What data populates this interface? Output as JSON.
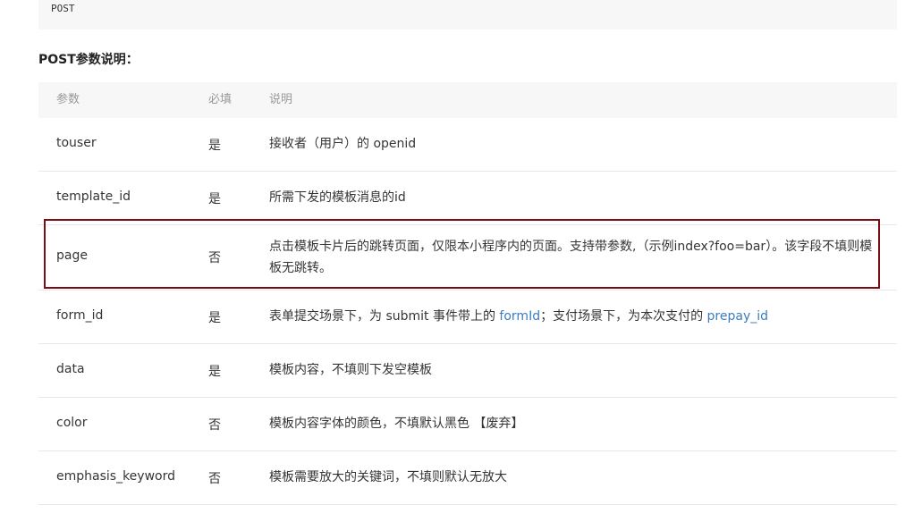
{
  "code_block": {
    "text": "POST"
  },
  "section_title": "POST参数说明：",
  "table": {
    "headers": {
      "param": "参数",
      "required": "必填",
      "desc": "说明"
    },
    "rows": [
      {
        "name": "touser",
        "required": "是",
        "desc": "接收者（用户）的 openid"
      },
      {
        "name": "template_id",
        "required": "是",
        "desc": "所需下发的模板消息的id"
      },
      {
        "name": "page",
        "required": "否",
        "desc": "点击模板卡片后的跳转页面，仅限本小程序内的页面。支持带参数,（示例index?foo=bar）。该字段不填则模板无跳转。"
      },
      {
        "name": "form_id",
        "required": "是",
        "desc_part1": "表单提交场景下，为 submit 事件带上的 ",
        "desc_link1": "formId",
        "desc_part2": "；支付场景下，为本次支付的 ",
        "desc_link2": "prepay_id"
      },
      {
        "name": "data",
        "required": "是",
        "desc": "模板内容，不填则下发空模板"
      },
      {
        "name": "color",
        "required": "否",
        "desc": "模板内容字体的颜色，不填默认黑色 【废弃】"
      },
      {
        "name": "emphasis_keyword",
        "required": "否",
        "desc": "模板需要放大的关键词，不填则默认无放大"
      }
    ]
  },
  "colors": {
    "highlight_border": "#7a0e17",
    "link": "#3b7cc1"
  }
}
